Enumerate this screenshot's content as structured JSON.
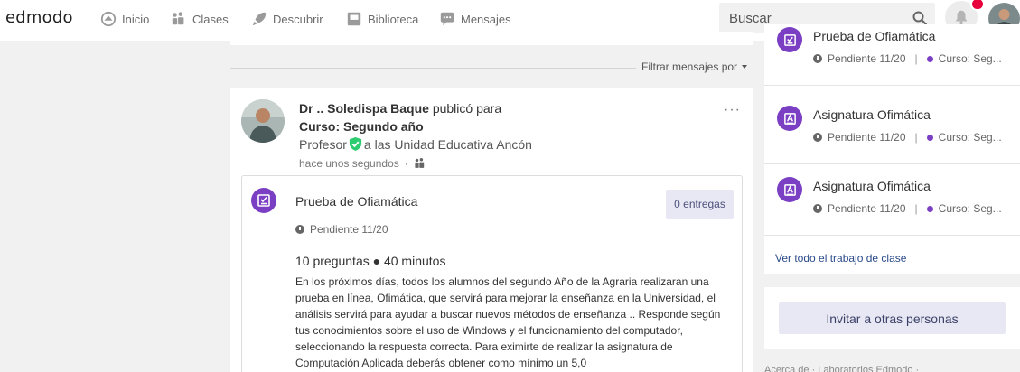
{
  "brand": {
    "logo_text": "edmodo",
    "accent": "#7b3fc4",
    "notif_color": "#e8003c"
  },
  "nav": {
    "items": [
      {
        "label": "Inicio",
        "icon": "home-icon"
      },
      {
        "label": "Clases",
        "icon": "classes-icon"
      },
      {
        "label": "Descubrir",
        "icon": "rocket-icon"
      },
      {
        "label": "Biblioteca",
        "icon": "library-icon"
      },
      {
        "label": "Mensajes",
        "icon": "chat-icon"
      }
    ],
    "search_placeholder": "Buscar"
  },
  "feed": {
    "filter_label": "Filtrar mensajes por",
    "post": {
      "author": "Dr .. Soledispa Baque",
      "action": "publicó para",
      "target": "Curso: Segundo año",
      "role_before": "Profesor",
      "role_after": "a las Unidad Educativa Ancón",
      "time": "hace unos segundos",
      "menu": "···",
      "assignment": {
        "title": "Prueba de Ofiamática",
        "submissions": "0 entregas",
        "due": "Pendiente 11/20",
        "meta": "10 preguntas ● 40 minutos",
        "description": "En los próximos días, todos los alumnos del segundo Año de la Agraria realizaran una prueba en línea, Ofimática, que servirá para mejorar la enseñanza en la Universidad, el análisis servirá para ayudar a buscar nuevos métodos de enseñanza .. Responde según tus conocimientos sobre el uso de Windows y el funcionamiento del computador, seleccionando la respuesta correcta. Para eximirte de realizar la asignatura de Computación Aplicada deberás obtener como mínimo un 5,0"
      }
    }
  },
  "sidebar": {
    "items": [
      {
        "title": "Prueba de Ofiamática",
        "due": "Pendiente 11/20",
        "course": "Curso: Seg...",
        "icon": "quiz-icon"
      },
      {
        "title": "Asignatura Ofimática",
        "due": "Pendiente 11/20",
        "course": "Curso: Seg...",
        "icon": "assignment-icon"
      },
      {
        "title": "Asignatura Ofimática",
        "due": "Pendiente 11/20",
        "course": "Curso: Seg...",
        "icon": "assignment-icon"
      }
    ],
    "see_all": "Ver todo el trabajo de clase",
    "invite": "Invitar a otras personas",
    "footer": "Acerca de · Laboratorios Edmodo ·"
  }
}
